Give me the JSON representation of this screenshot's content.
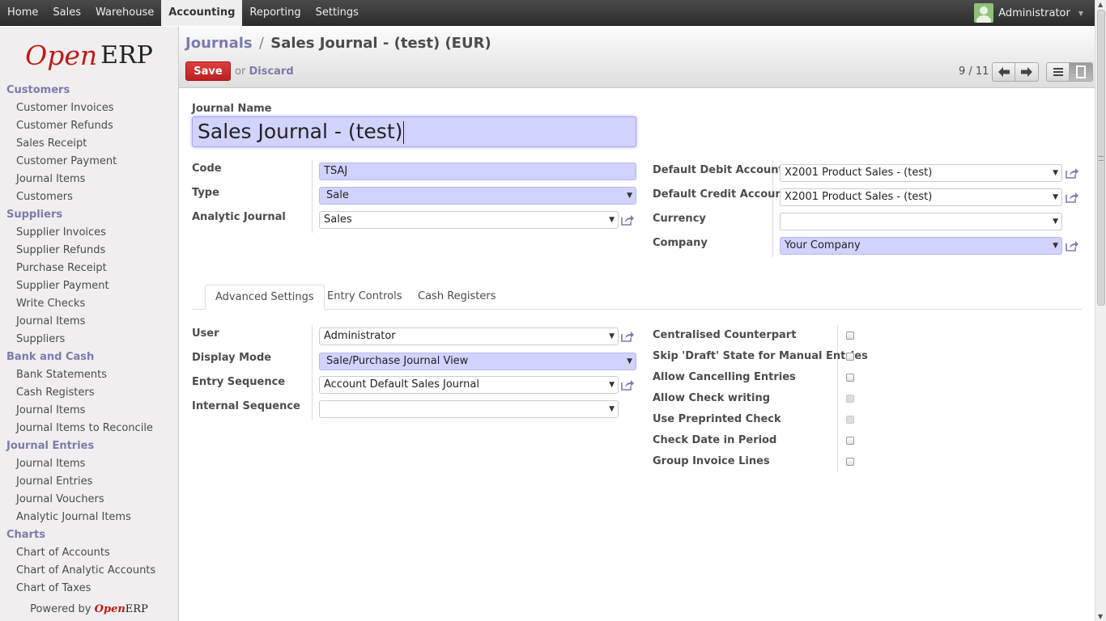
{
  "topnav": {
    "items": [
      "Home",
      "Sales",
      "Warehouse",
      "Accounting",
      "Reporting",
      "Settings"
    ],
    "active": "Accounting",
    "user": "Administrator"
  },
  "logo": {
    "open": "Open",
    "erp": "ERP"
  },
  "sidebar": {
    "sections": [
      {
        "title": "Customers",
        "items": [
          "Customer Invoices",
          "Customer Refunds",
          "Sales Receipt",
          "Customer Payment",
          "Journal Items",
          "Customers"
        ]
      },
      {
        "title": "Suppliers",
        "items": [
          "Supplier Invoices",
          "Supplier Refunds",
          "Purchase Receipt",
          "Supplier Payment",
          "Write Checks",
          "Journal Items",
          "Suppliers"
        ]
      },
      {
        "title": "Bank and Cash",
        "items": [
          "Bank Statements",
          "Cash Registers",
          "Journal Items",
          "Journal Items to Reconcile"
        ]
      },
      {
        "title": "Journal Entries",
        "items": [
          "Journal Items",
          "Journal Entries",
          "Journal Vouchers",
          "Analytic Journal Items"
        ]
      },
      {
        "title": "Charts",
        "items": [
          "Chart of Accounts",
          "Chart of Analytic Accounts",
          "Chart of Taxes"
        ]
      }
    ],
    "powered_by": "Powered by",
    "powered_open": "Open",
    "powered_erp": "ERP"
  },
  "header": {
    "breadcrumb_parent": "Journals",
    "breadcrumb_sep": "/",
    "breadcrumb_current": "Sales Journal - (test) (EUR)",
    "save_label": "Save",
    "or_label": "or",
    "discard_label": "Discard",
    "pager": "9 / 11"
  },
  "form": {
    "name_label": "Journal Name",
    "name_value": "Sales Journal - (test)",
    "left": [
      {
        "label": "Code",
        "value": "TSAJ",
        "kind": "input"
      },
      {
        "label": "Type",
        "value": "Sale",
        "kind": "select"
      },
      {
        "label": "Analytic Journal",
        "value": "Sales",
        "kind": "many2one"
      }
    ],
    "right": [
      {
        "label": "Default Debit Account",
        "value": "X2001 Product Sales - (test)"
      },
      {
        "label": "Default Credit Account",
        "value": "X2001 Product Sales - (test)"
      },
      {
        "label": "Currency",
        "value": ""
      },
      {
        "label": "Company",
        "value": "Your Company"
      }
    ]
  },
  "tabs": [
    "Advanced Settings",
    "Entry Controls",
    "Cash Registers"
  ],
  "advanced": {
    "left": [
      {
        "label": "User",
        "value": "Administrator"
      },
      {
        "label": "Display Mode",
        "value": "Sale/Purchase Journal View"
      },
      {
        "label": "Entry Sequence",
        "value": "Account Default Sales Journal"
      },
      {
        "label": "Internal Sequence",
        "value": ""
      }
    ],
    "checks": [
      {
        "label": "Centralised Counterpart",
        "checked": false,
        "disabled": false
      },
      {
        "label": "Skip 'Draft' State for Manual Entries",
        "checked": false,
        "disabled": false
      },
      {
        "label": "Allow Cancelling Entries",
        "checked": false,
        "disabled": false
      },
      {
        "label": "Allow Check writing",
        "checked": false,
        "disabled": true
      },
      {
        "label": "Use Preprinted Check",
        "checked": false,
        "disabled": true
      },
      {
        "label": "Check Date in Period",
        "checked": false,
        "disabled": false
      },
      {
        "label": "Group Invoice Lines",
        "checked": false,
        "disabled": false
      }
    ]
  },
  "colors": {
    "accent": "#7c7bad",
    "required_bg": "#d2d2ff",
    "save_button": "#c52828",
    "logo_red": "#c01a1a"
  },
  "icons": [
    "external-link-icon",
    "arrow-left-icon",
    "arrow-right-icon",
    "list-view-icon",
    "form-view-icon",
    "dropdown-caret-icon"
  ]
}
